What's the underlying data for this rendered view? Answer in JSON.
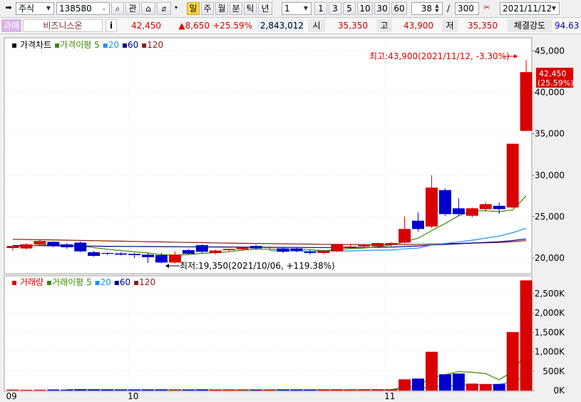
{
  "toolbar": {
    "market_select": "주식",
    "code_input": "138580",
    "btn_relation": "관",
    "periods": [
      "일",
      "주",
      "월",
      "분",
      "틱",
      "년"
    ],
    "active_period": "일",
    "interval_value": "1",
    "interval_presets": [
      "1",
      "3",
      "5",
      "10",
      "30",
      "60"
    ],
    "count_value": "38",
    "count_sep": "/",
    "count_total": "300",
    "date_value": "2021/11/12"
  },
  "quote": {
    "market_badge": "과매",
    "name": "비즈니스온",
    "info_icon": "i",
    "price": "42,450",
    "change": "▲8,650",
    "change_pct": "+25.59%",
    "volume": "2,843,012",
    "open_label": "시",
    "open": "35,350",
    "high_label": "고",
    "high": "43,900",
    "low_label": "저",
    "low": "35,350",
    "strength_label": "체결강도",
    "strength": "94.63",
    "colors": {
      "up": "#d80000",
      "down": "#0000cc",
      "badge_bg": "#d8b4e8"
    }
  },
  "chart_data": [
    {
      "type": "candlestick",
      "legend": {
        "title": "가격차트",
        "ma_label": "가격이평",
        "ma_periods": [
          "5",
          "20",
          "60",
          "120"
        ]
      },
      "x_labels": [
        {
          "label": "09",
          "index": 0
        },
        {
          "label": "10",
          "index": 9
        },
        {
          "label": "11",
          "index": 28
        }
      ],
      "y_ticks": [
        "45,000",
        "40,000",
        "35,000",
        "30,000",
        "25,000",
        "20,000"
      ],
      "y_tick_values": [
        45000,
        40000,
        35000,
        30000,
        25000,
        20000
      ],
      "ylim": [
        18100,
        46600
      ],
      "candles": [
        {
          "o": 21200,
          "h": 21500,
          "l": 20900,
          "c": 21450
        },
        {
          "o": 21150,
          "h": 21800,
          "l": 21000,
          "c": 21650
        },
        {
          "o": 21650,
          "h": 22200,
          "l": 21550,
          "c": 22050
        },
        {
          "o": 21950,
          "h": 22000,
          "l": 21300,
          "c": 21500
        },
        {
          "o": 21650,
          "h": 21800,
          "l": 21100,
          "c": 21300
        },
        {
          "o": 21850,
          "h": 22000,
          "l": 20700,
          "c": 20800
        },
        {
          "o": 20700,
          "h": 20850,
          "l": 20150,
          "c": 20250
        },
        {
          "o": 20600,
          "h": 20700,
          "l": 20350,
          "c": 20500
        },
        {
          "o": 20550,
          "h": 20700,
          "l": 20300,
          "c": 20400
        },
        {
          "o": 20500,
          "h": 20650,
          "l": 20000,
          "c": 20350
        },
        {
          "o": 20400,
          "h": 20600,
          "l": 19400,
          "c": 20100
        },
        {
          "o": 20350,
          "h": 20600,
          "l": 19350,
          "c": 19450
        },
        {
          "o": 19450,
          "h": 20800,
          "l": 19350,
          "c": 20400
        },
        {
          "o": 20950,
          "h": 21100,
          "l": 20400,
          "c": 20500
        },
        {
          "o": 21550,
          "h": 21650,
          "l": 20600,
          "c": 20750
        },
        {
          "o": 20600,
          "h": 21000,
          "l": 20400,
          "c": 20900
        },
        {
          "o": 20950,
          "h": 21150,
          "l": 20800,
          "c": 21100
        },
        {
          "o": 21050,
          "h": 21300,
          "l": 20900,
          "c": 21250
        },
        {
          "o": 21450,
          "h": 21600,
          "l": 21000,
          "c": 21150
        },
        {
          "o": 21250,
          "h": 21400,
          "l": 21000,
          "c": 21300
        },
        {
          "o": 21150,
          "h": 21300,
          "l": 20600,
          "c": 20750
        },
        {
          "o": 21150,
          "h": 21300,
          "l": 20700,
          "c": 20850
        },
        {
          "o": 20750,
          "h": 20950,
          "l": 20400,
          "c": 20600
        },
        {
          "o": 20600,
          "h": 20950,
          "l": 20450,
          "c": 20850
        },
        {
          "o": 20800,
          "h": 21700,
          "l": 20700,
          "c": 21600
        },
        {
          "o": 21300,
          "h": 21700,
          "l": 21200,
          "c": 21400
        },
        {
          "o": 21400,
          "h": 21700,
          "l": 21200,
          "c": 21550
        },
        {
          "o": 21400,
          "h": 21900,
          "l": 21300,
          "c": 21800
        },
        {
          "o": 21650,
          "h": 21900,
          "l": 21400,
          "c": 21800
        },
        {
          "o": 21850,
          "h": 25000,
          "l": 21750,
          "c": 23500
        },
        {
          "o": 24500,
          "h": 25500,
          "l": 23200,
          "c": 23500
        },
        {
          "o": 23800,
          "h": 30000,
          "l": 23600,
          "c": 28500
        },
        {
          "o": 28200,
          "h": 28400,
          "l": 25100,
          "c": 25300
        },
        {
          "o": 26000,
          "h": 27200,
          "l": 25100,
          "c": 25300
        },
        {
          "o": 25100,
          "h": 26100,
          "l": 24900,
          "c": 26000
        },
        {
          "o": 25900,
          "h": 26700,
          "l": 25600,
          "c": 26500
        },
        {
          "o": 26300,
          "h": 26700,
          "l": 25300,
          "c": 25900
        },
        {
          "o": 26100,
          "h": 33800,
          "l": 26000,
          "c": 33800
        },
        {
          "o": 35350,
          "h": 43900,
          "l": 35350,
          "c": 42450
        }
      ],
      "ma5": [
        21400,
        21450,
        21550,
        21600,
        21550,
        21450,
        21250,
        21050,
        20900,
        20750,
        20600,
        20400,
        20350,
        20400,
        20550,
        20650,
        20750,
        20950,
        21050,
        21050,
        21050,
        21050,
        21000,
        20900,
        21000,
        21150,
        21200,
        21350,
        21550,
        21950,
        22400,
        23300,
        24150,
        25100,
        25700,
        25700,
        25600,
        25800,
        27500
      ],
      "ma20": [
        null,
        null,
        null,
        null,
        null,
        null,
        null,
        null,
        null,
        null,
        null,
        null,
        null,
        null,
        null,
        null,
        null,
        null,
        null,
        20900,
        20850,
        20850,
        20800,
        20850,
        20850,
        20850,
        20900,
        20950,
        20950,
        21100,
        21200,
        21550,
        21750,
        21950,
        22150,
        22400,
        22650,
        23050,
        23600
      ],
      "ma60": [
        21500,
        21500,
        21480,
        21470,
        21450,
        21440,
        21430,
        21410,
        21400,
        21390,
        21380,
        21370,
        21360,
        21350,
        21340,
        21330,
        21320,
        21310,
        21300,
        21290,
        21280,
        21270,
        21260,
        21260,
        21260,
        21260,
        21270,
        21290,
        21310,
        21380,
        21450,
        21560,
        21640,
        21720,
        21800,
        21880,
        21960,
        22100,
        22300
      ],
      "ma120": [
        22250,
        22230,
        22200,
        22180,
        22150,
        22120,
        22090,
        22060,
        22030,
        22000,
        21970,
        21940,
        21910,
        21880,
        21850,
        21820,
        21790,
        21770,
        21750,
        21730,
        21710,
        21690,
        21670,
        21650,
        21640,
        21630,
        21620,
        21620,
        21620,
        21630,
        21650,
        21690,
        21720,
        21760,
        21800,
        21840,
        21880,
        21960,
        22100
      ],
      "annotation_high": "최고:43,900(2021/11/12, -3.30%)",
      "annotation_low": "최저:19,350(2021/10/06, +119.38%)",
      "last_price_label": "42,450",
      "last_pct_label": "(25.59%)"
    },
    {
      "type": "bar",
      "legend": {
        "title": "거래량",
        "ma_label": "거래이평",
        "ma_periods": [
          "5",
          "20",
          "60",
          "120"
        ]
      },
      "y_ticks": [
        "2,500K",
        "2,000K",
        "1,500K",
        "1,000K",
        "500K",
        "0K"
      ],
      "y_tick_values": [
        2500,
        2000,
        1500,
        1000,
        500,
        0
      ],
      "ylim": [
        0,
        2960
      ],
      "unit": "K",
      "volumes": [
        25,
        20,
        22,
        28,
        24,
        30,
        26,
        22,
        20,
        18,
        25,
        28,
        20,
        22,
        24,
        18,
        20,
        22,
        18,
        20,
        22,
        18,
        20,
        22,
        25,
        20,
        25,
        30,
        28,
        290,
        310,
        1000,
        420,
        440,
        180,
        170,
        170,
        1510,
        2843
      ],
      "vma5": [
        null,
        null,
        null,
        null,
        24,
        25,
        26,
        26,
        24,
        23,
        22,
        22,
        22,
        22,
        24,
        22,
        21,
        21,
        20,
        20,
        20,
        20,
        20,
        20,
        21,
        21,
        22,
        24,
        26,
        80,
        135,
        330,
        410,
        490,
        470,
        440,
        280,
        490,
        970
      ],
      "vma20": [
        null,
        null,
        null,
        null,
        null,
        null,
        null,
        null,
        null,
        null,
        null,
        null,
        null,
        null,
        null,
        null,
        null,
        null,
        null,
        22,
        22,
        22,
        22,
        22,
        22,
        22,
        22,
        22,
        22,
        35,
        48,
        96,
        115,
        136,
        144,
        152,
        160,
        234,
        370
      ]
    }
  ]
}
